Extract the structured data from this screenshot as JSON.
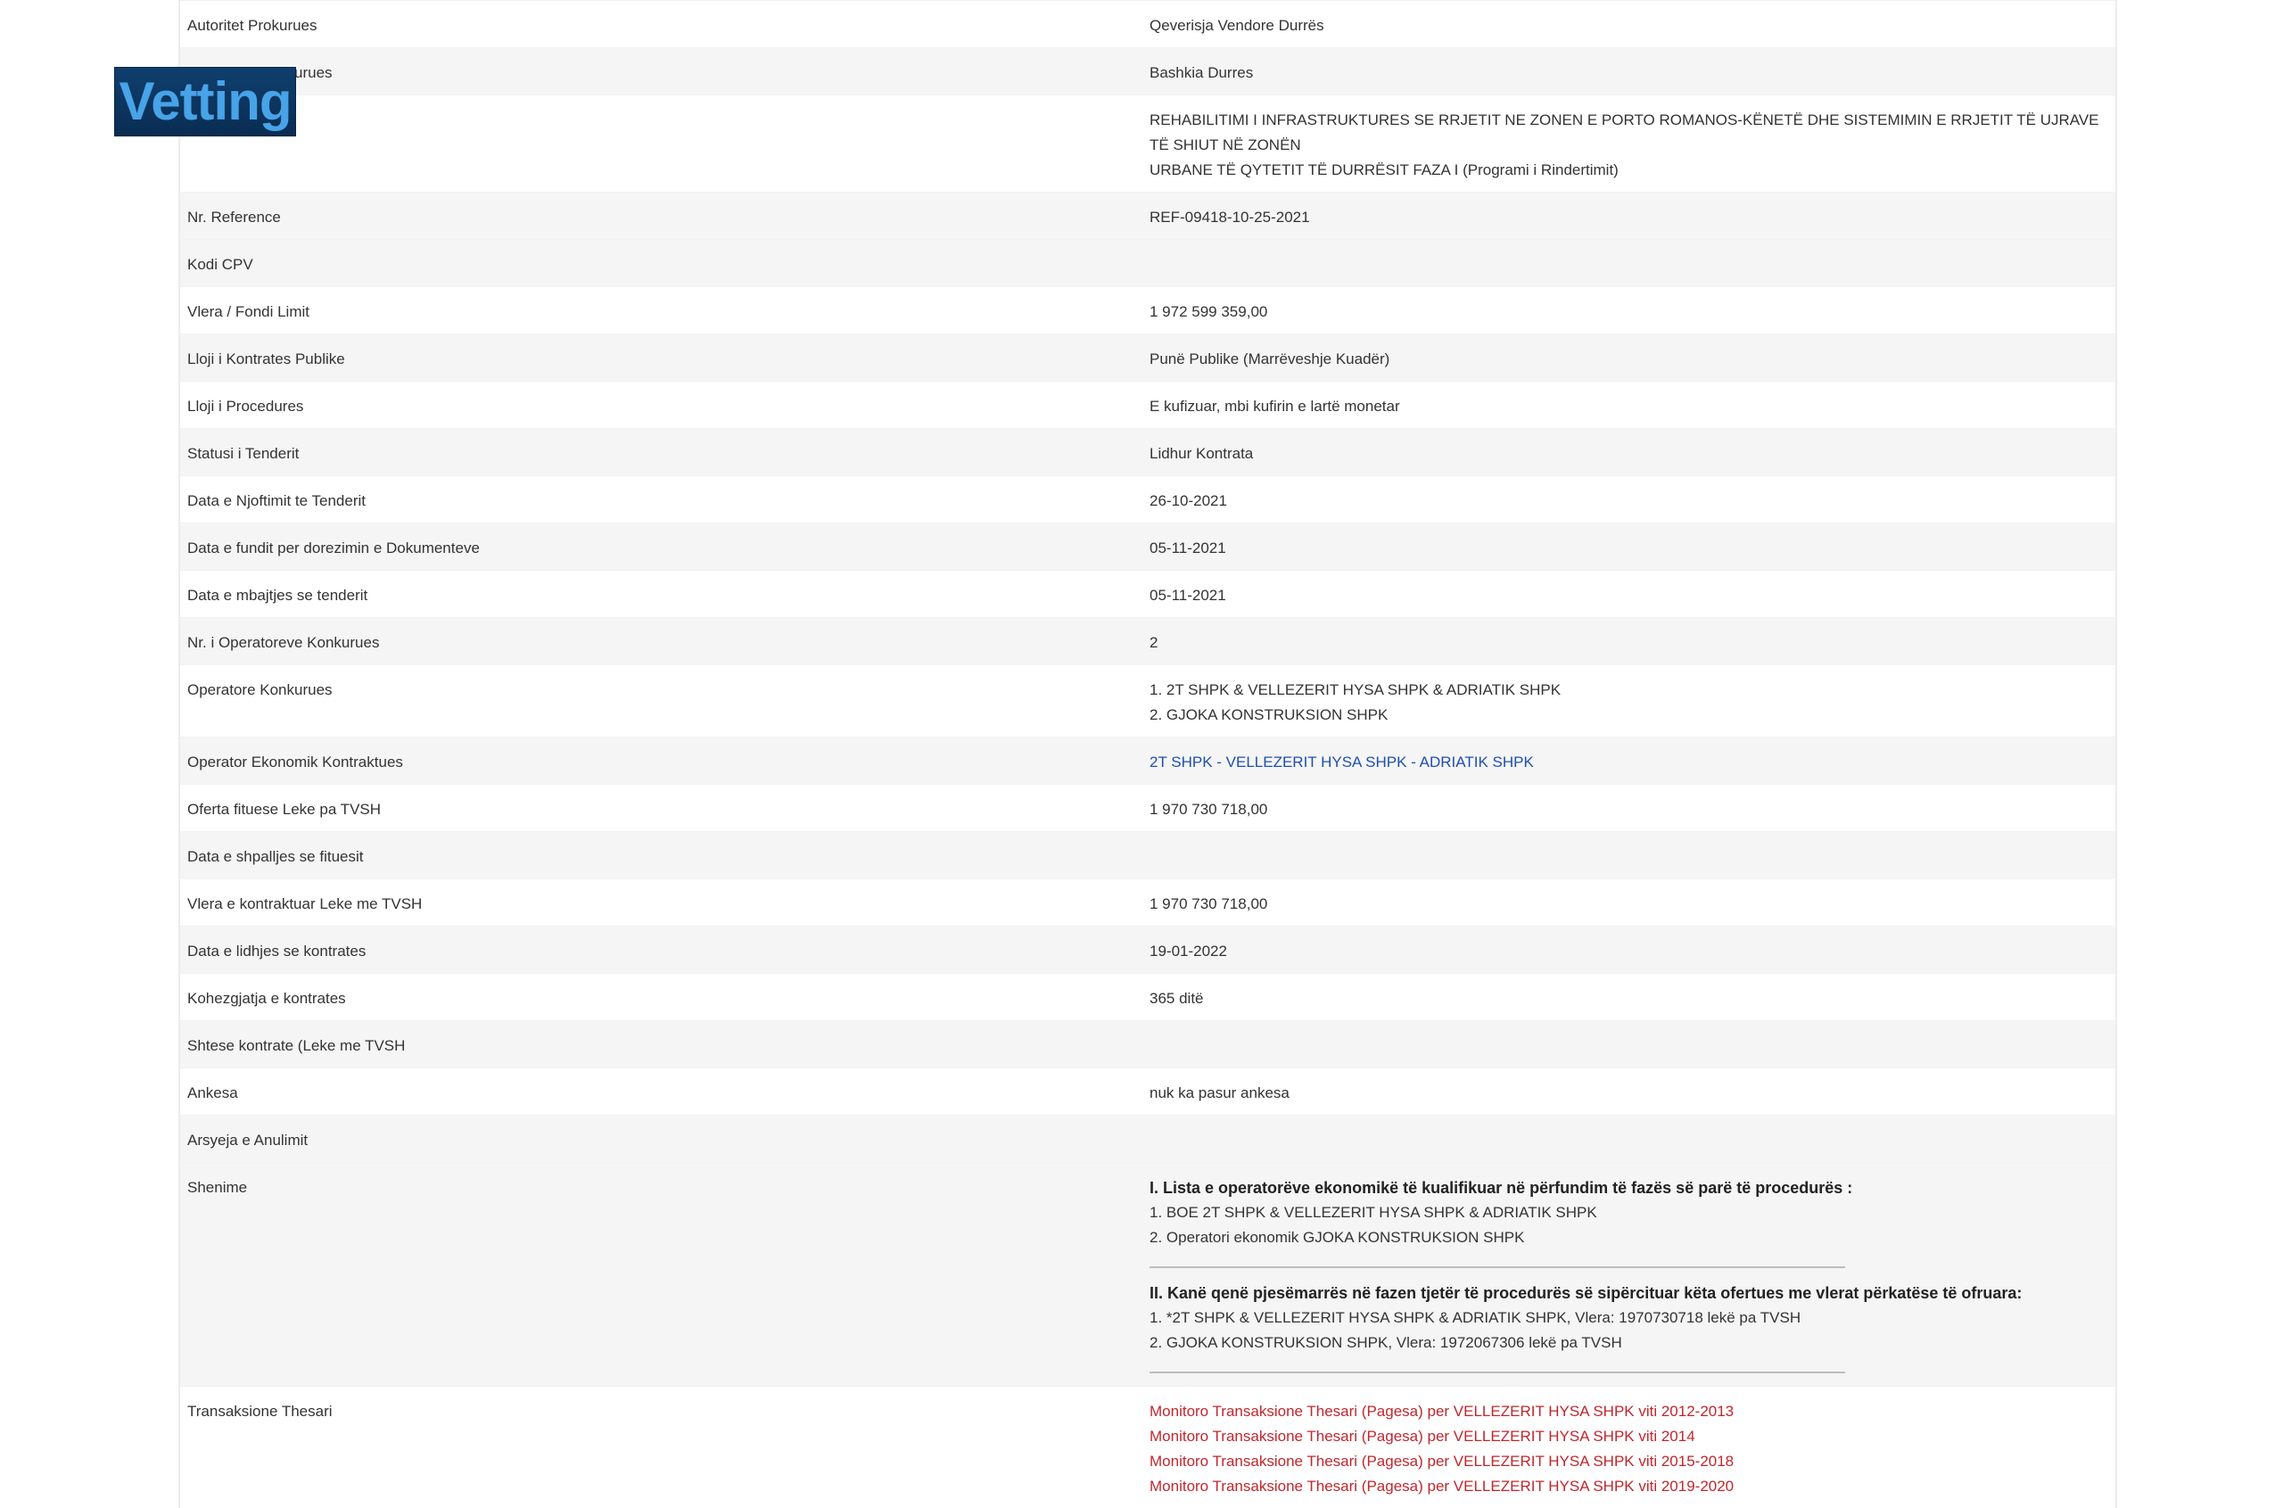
{
  "logo": {
    "text": "Vetting"
  },
  "rows": [
    {
      "label": "Autoritet Prokurues",
      "value": "Qeverisja Vendore Durrës"
    },
    {
      "label": "Institucioni Prokurues",
      "value": "Bashkia Durres"
    },
    {
      "label": "",
      "value_lines": [
        "REHABILITIMI I INFRASTRUKTURES SE RRJETIT NE ZONEN E PORTO ROMANOS-KËNETË DHE SISTEMIMIN E RRJETIT TË UJRAVE TË SHIUT NË ZONËN",
        "URBANE TË QYTETIT TË DURRËSIT FAZA I (Programi i Rindertimit)"
      ]
    },
    {
      "label": "Nr. Reference",
      "value": "REF-09418-10-25-2021"
    },
    {
      "label": "Kodi CPV",
      "value": ""
    },
    {
      "label": "Vlera / Fondi Limit",
      "value": "1 972 599 359,00"
    },
    {
      "label": "Lloji i Kontrates Publike",
      "value": "Punë Publike (Marrëveshje Kuadër)"
    },
    {
      "label": "Lloji i Procedures",
      "value": "E kufizuar, mbi kufirin e lartë monetar"
    },
    {
      "label": "Statusi i Tenderit",
      "value": "Lidhur Kontrata"
    },
    {
      "label": "Data e Njoftimit te Tenderit",
      "value": "26-10-2021"
    },
    {
      "label": "Data e fundit per dorezimin e Dokumenteve",
      "value": "05-11-2021"
    },
    {
      "label": "Data e mbajtjes se tenderit",
      "value": "05-11-2021"
    },
    {
      "label": "Nr. i Operatoreve Konkurues",
      "value": "2"
    },
    {
      "label": "Operatore Konkurues",
      "value_lines": [
        "1. 2T SHPK & VELLEZERIT HYSA SHPK & ADRIATIK SHPK",
        "2. GJOKA KONSTRUKSION SHPK"
      ]
    },
    {
      "label": "Operator Ekonomik Kontraktues",
      "link": "2T SHPK - VELLEZERIT HYSA SHPK - ADRIATIK SHPK"
    },
    {
      "label": "Oferta fituese Leke pa TVSH",
      "value": "1 970 730 718,00"
    },
    {
      "label": "Data e shpalljes se fituesit",
      "value": ""
    },
    {
      "label": "Vlera e kontraktuar Leke me TVSH",
      "value": "1 970 730 718,00"
    },
    {
      "label": "Data e lidhjes se kontrates",
      "value": "19-01-2022"
    },
    {
      "label": "Kohezgjatja e kontrates",
      "value": "365 ditë"
    },
    {
      "label": "Shtese kontrate (Leke me TVSH",
      "value": ""
    },
    {
      "label": "Ankesa",
      "value": "nuk ka pasur ankesa"
    },
    {
      "label": "Arsyeja e Anulimit",
      "value": ""
    }
  ],
  "notes": {
    "label": "Shenime",
    "section1_head": "I. Lista e operatorëve ekonomikë të kualifikuar në përfundim të fazës së parë të procedurës :",
    "section1_lines": [
      "1. BOE 2T SHPK & VELLEZERIT HYSA SHPK & ADRIATIK SHPK",
      "2. Operatori ekonomik GJOKA KONSTRUKSION SHPK"
    ],
    "section2_head": "II. Kanë qenë pjesëmarrës në fazen tjetër të procedurës së sipërcituar këta ofertues me vlerat përkatëse të ofruara:",
    "section2_lines": [
      "1. *2T SHPK & VELLEZERIT HYSA SHPK & ADRIATIK SHPK, Vlera: 1970730718 lekë pa TVSH",
      "2. GJOKA KONSTRUKSION SHPK, Vlera: 1972067306 lekë pa TVSH"
    ]
  },
  "treasury": {
    "label": "Transaksione Thesari",
    "links": [
      "Monitoro Transaksione Thesari (Pagesa) per VELLEZERIT HYSA SHPK viti 2012-2013",
      "Monitoro Transaksione Thesari (Pagesa) per VELLEZERIT HYSA SHPK viti 2014",
      "Monitoro Transaksione Thesari (Pagesa) per VELLEZERIT HYSA SHPK viti 2015-2018",
      "Monitoro Transaksione Thesari (Pagesa) per VELLEZERIT HYSA SHPK viti 2019-2020"
    ]
  },
  "colors": {
    "link_blue": "#1f4fb0",
    "link_red": "#c0272d",
    "row_alt": "#f5f5f5"
  }
}
